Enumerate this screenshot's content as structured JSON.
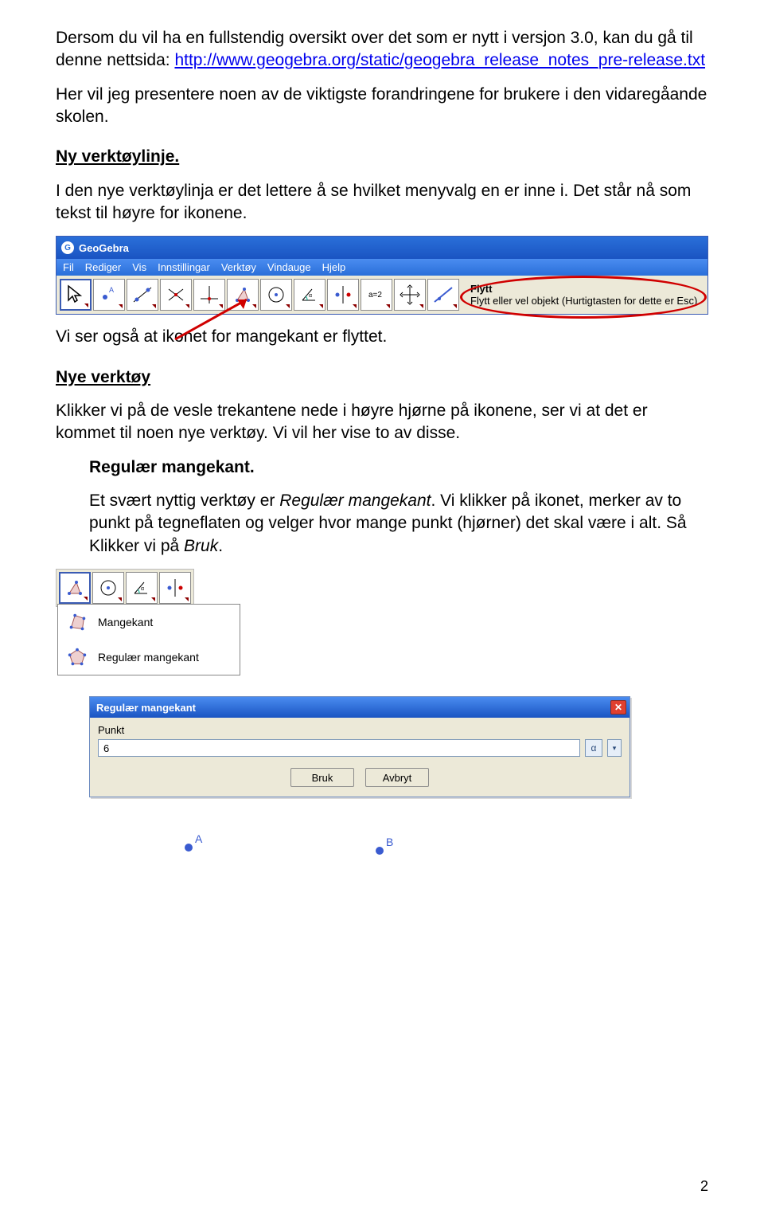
{
  "intro": {
    "p1a": "Dersom du vil ha en fullstendig oversikt over det som er nytt i versjon 3.0, kan du gå til denne nettsida: ",
    "link": "http://www.geogebra.org/static/geogebra_release_notes_pre-release.txt",
    "p2": "Her vil jeg presentere noen av de viktigste forandringene for brukere i den vidaregåande skolen."
  },
  "sec1": {
    "title": "Ny verktøylinje.",
    "p1": "I den nye verktøylinja er det lettere å se hvilket menyvalg en er inne i. Det står nå som tekst til høyre for ikonene."
  },
  "geogebra": {
    "app_name": "GeoGebra",
    "menus": [
      "Fil",
      "Rediger",
      "Vis",
      "Innstillingar",
      "Verktøy",
      "Vindauge",
      "Hjelp"
    ],
    "hint_title": "Flytt",
    "hint_text": "Flytt eller vel objekt (Hurtigtasten for dette er Esc)"
  },
  "sec2": {
    "p1": "Vi ser også at ikonet for mangekant er flyttet.",
    "title": "Nye verktøy",
    "p2": "Klikker vi på de vesle trekantene nede i høyre hjørne på ikonene, ser vi at det er kommet til noen nye verktøy. Vi vil her vise to av disse.",
    "sub_title": "Regulær mangekant.",
    "p3a": "Et svært nyttig verktøy er ",
    "p3b": "Regulær mangekant",
    "p3c": ". Vi klikker på ikonet, merker av to punkt på tegneflaten og velger hvor mange punkt (hjørner) det skal være i alt. Så Klikker vi på ",
    "p3d": "Bruk",
    "p3e": "."
  },
  "submenu": {
    "item1": "Mangekant",
    "item2": "Regulær mangekant"
  },
  "dialog": {
    "title": "Regulær mangekant",
    "label": "Punkt",
    "value": "6",
    "alpha": "α",
    "btn_ok": "Bruk",
    "btn_cancel": "Avbryt"
  },
  "points": {
    "A": "A",
    "B": "B"
  },
  "page": "2"
}
